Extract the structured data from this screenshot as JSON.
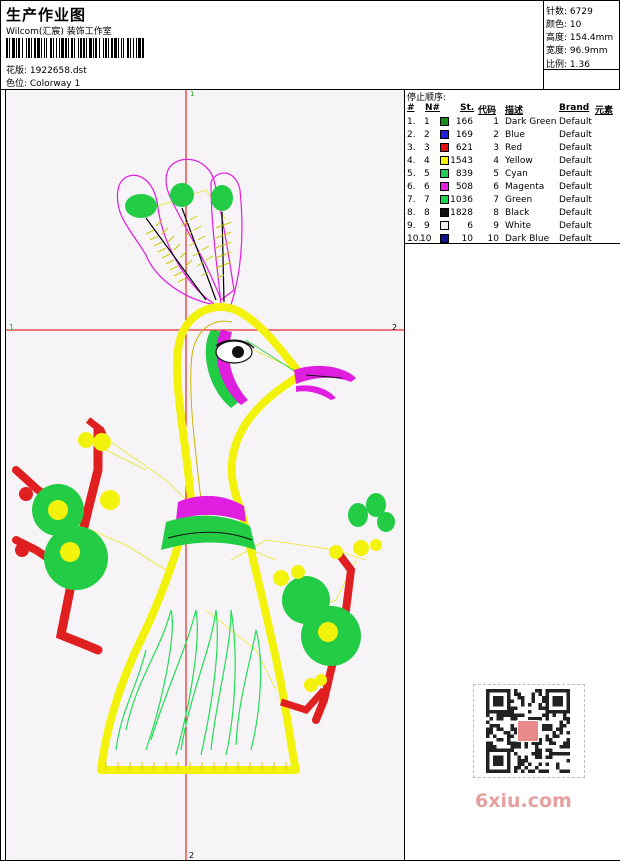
{
  "header": {
    "title": "生产作业图",
    "studio": "Wilcom(汇宸) 装饰工作室",
    "pattern": "花版: 1922658.dst",
    "colorway": "色位: Colorway 1"
  },
  "stats": {
    "stitches": "针数: 6729",
    "colors": "颜色: 10",
    "height": "高度: 154.4mm",
    "width": "宽度: 96.9mm",
    "ratio": "比例: 1.36"
  },
  "design_axes": {
    "top": "1",
    "left": "1",
    "right": "2",
    "bottom": "2"
  },
  "stop_sequence": {
    "title": "停止顺序:",
    "headers": {
      "hash": "#",
      "no": "N#",
      "st": "St.",
      "code": "代码",
      "desc": "描述",
      "brand": "Brand",
      "element": "元素"
    },
    "rows": [
      {
        "idx": "1.",
        "no": "1",
        "color": "#1a8c1a",
        "st": "166",
        "code": "1",
        "desc": "Dark Green",
        "brand": "Default"
      },
      {
        "idx": "2.",
        "no": "2",
        "color": "#1e1ed6",
        "st": "169",
        "code": "2",
        "desc": "Blue",
        "brand": "Default"
      },
      {
        "idx": "3.",
        "no": "3",
        "color": "#e01010",
        "st": "621",
        "code": "3",
        "desc": "Red",
        "brand": "Default"
      },
      {
        "idx": "4.",
        "no": "4",
        "color": "#f2f20c",
        "st": "1543",
        "code": "4",
        "desc": "Yellow",
        "brand": "Default"
      },
      {
        "idx": "5.",
        "no": "5",
        "color": "#22cc55",
        "st": "839",
        "code": "5",
        "desc": "Cyan",
        "brand": "Default"
      },
      {
        "idx": "6.",
        "no": "6",
        "color": "#e01ee0",
        "st": "508",
        "code": "6",
        "desc": "Magenta",
        "brand": "Default"
      },
      {
        "idx": "7.",
        "no": "7",
        "color": "#18d84a",
        "st": "1036",
        "code": "7",
        "desc": "Green",
        "brand": "Default"
      },
      {
        "idx": "8.",
        "no": "8",
        "color": "#111111",
        "st": "1828",
        "code": "8",
        "desc": "Black",
        "brand": "Default"
      },
      {
        "idx": "9.",
        "no": "9",
        "color": "#f2f2f2",
        "st": "6",
        "code": "9",
        "desc": "White",
        "brand": "Default"
      },
      {
        "idx": "10.",
        "no": "10",
        "color": "#12128c",
        "st": "10",
        "code": "10",
        "desc": "Dark Blue",
        "brand": "Default"
      }
    ]
  },
  "watermark": "6xiu.com",
  "colors": {
    "yellow": "#f2f20c",
    "green": "#22cc44",
    "red": "#e02020",
    "magenta": "#e01ee0",
    "guide": "#e00000"
  }
}
